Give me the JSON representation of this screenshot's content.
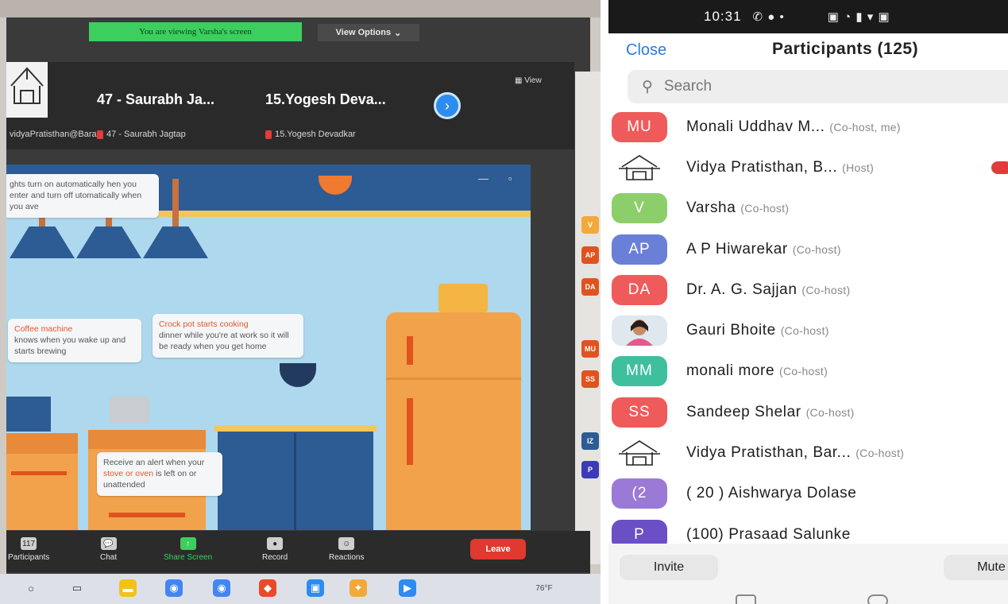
{
  "desktop": {
    "share_banner": "You are viewing Varsha's screen",
    "view_options": "View Options",
    "view_tag": "View",
    "thumb_1_sub": "vidyaPratisthan@Bara...",
    "tiles": [
      {
        "name": "47 - Saurabh Ja...",
        "sub": "47 - Saurabh Jagtap"
      },
      {
        "name": "15.Yogesh Deva...",
        "sub": "15.Yogesh Devadkar"
      }
    ],
    "slide": {
      "bubble_lights": "ghts turn on automatically hen you enter and turn off utomatically when you ave",
      "bubble_coffee_title": "Coffee machine",
      "bubble_coffee_body": "knows when you wake up and starts brewing",
      "bubble_crock_title": "Crock pot starts cooking",
      "bubble_crock_body": "dinner while you're at work so it will be ready when you get home",
      "bubble_alert_a": "Receive an alert when your",
      "bubble_alert_b": "stove or oven",
      "bubble_alert_c": "is left on or unattended"
    },
    "side_avatars": [
      "MU",
      "V",
      "AP",
      "DA",
      "MU",
      "SS",
      "IZ",
      "P"
    ],
    "toolbar": {
      "participants_count": "117",
      "participants": "Participants",
      "chat": "Chat",
      "share_screen": "Share Screen",
      "record": "Record",
      "reactions": "Reactions",
      "leave": "Leave"
    },
    "tray_temp": "76°F"
  },
  "phone": {
    "time": "10:31",
    "close": "Close",
    "title": "Participants (125)",
    "search_placeholder": "Search",
    "participants": [
      {
        "initials": "MU",
        "color": "#ef5b5b",
        "name": "Monali Uddhav M...",
        "role": "(Co-host, me)"
      },
      {
        "initials": "",
        "color": "#ffffff",
        "name": "Vidya Pratisthan, B...",
        "role": "(Host)",
        "logo": true
      },
      {
        "initials": "V",
        "color": "#8ccf6a",
        "name": "Varsha",
        "role": "(Co-host)"
      },
      {
        "initials": "AP",
        "color": "#6a7fd6",
        "name": "A P Hiwarekar",
        "role": "(Co-host)"
      },
      {
        "initials": "DA",
        "color": "#ef5b5b",
        "name": "Dr. A. G. Sajjan",
        "role": "(Co-host)"
      },
      {
        "initials": "",
        "color": "#dfe7ef",
        "name": "Gauri Bhoite",
        "role": "(Co-host)",
        "photo": true
      },
      {
        "initials": "MM",
        "color": "#3fbf9e",
        "name": "monali more",
        "role": "(Co-host)"
      },
      {
        "initials": "SS",
        "color": "#ef5b5b",
        "name": "Sandeep Shelar",
        "role": "(Co-host)"
      },
      {
        "initials": "",
        "color": "#ffffff",
        "name": "Vidya Pratisthan, Bar...",
        "role": "(Co-host)",
        "logo": true
      },
      {
        "initials": "(2",
        "color": "#9a7ad6",
        "name": "( 20 ) Aishwarya Dolase",
        "role": ""
      },
      {
        "initials": "P",
        "color": "#6a4fc6",
        "name": "(100) Prasaad Salunke",
        "role": ""
      }
    ],
    "invite": "Invite",
    "mute": "Mute"
  }
}
